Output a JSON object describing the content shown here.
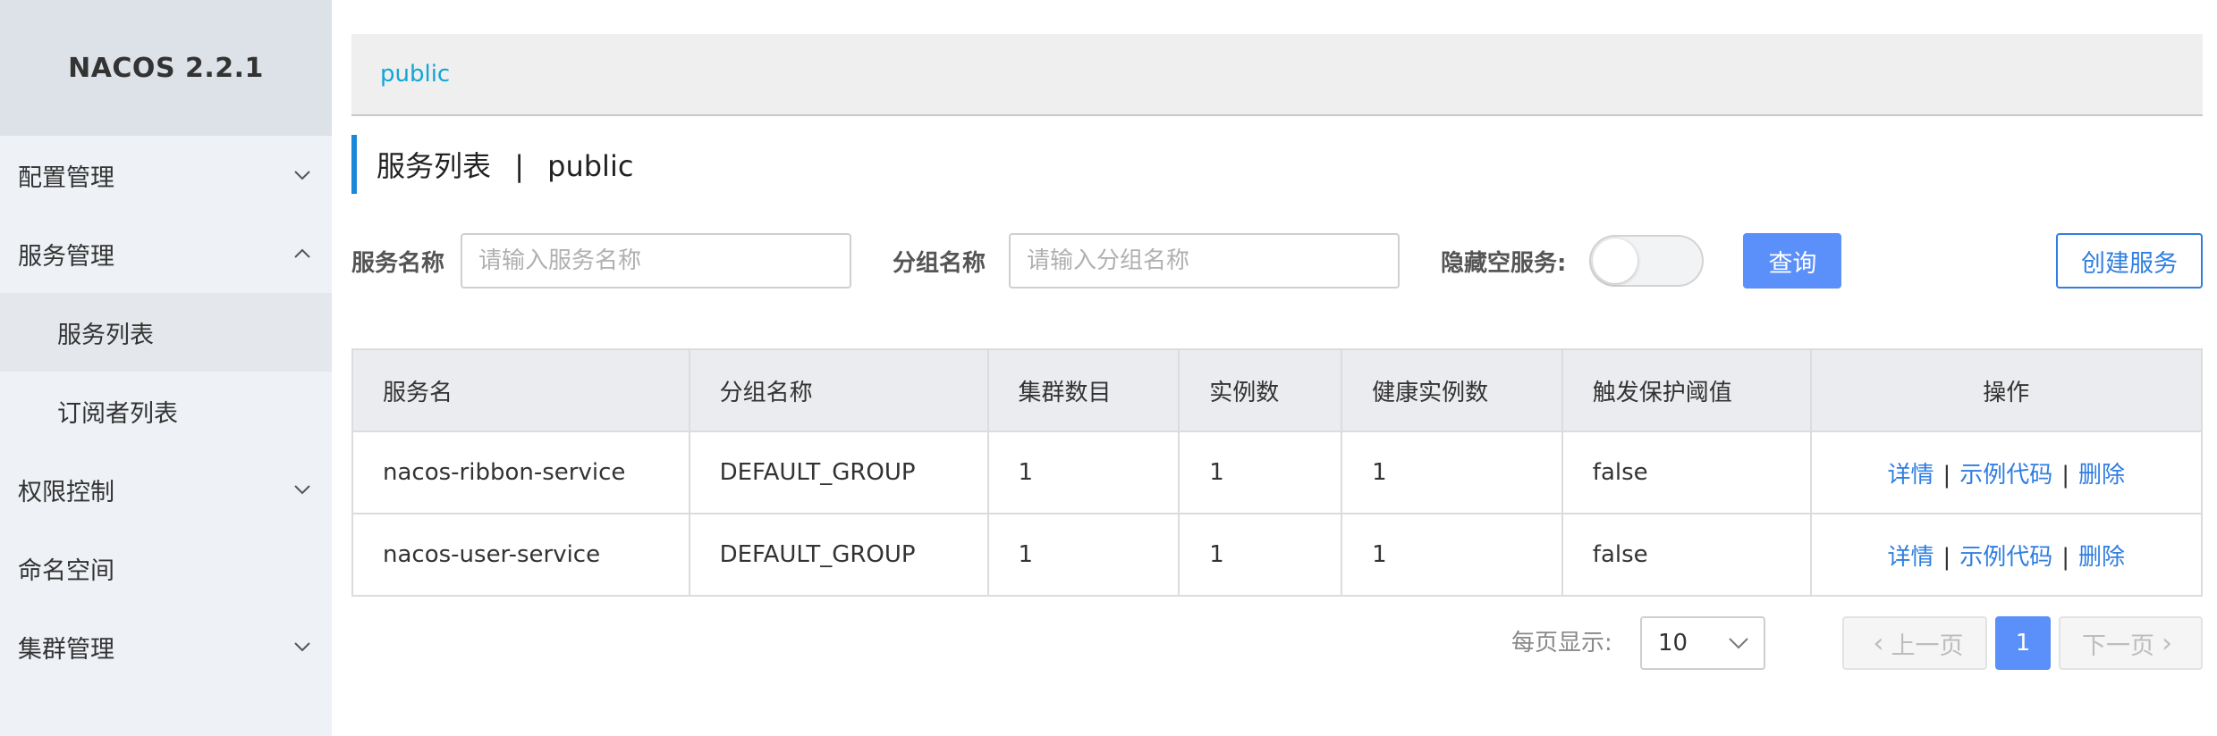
{
  "app": {
    "logo": "NACOS 2.2.1"
  },
  "sidebar": {
    "items": [
      {
        "label": "配置管理",
        "chevron": "down"
      },
      {
        "label": "服务管理",
        "chevron": "up"
      },
      {
        "label": "服务列表",
        "sub": true,
        "active": true
      },
      {
        "label": "订阅者列表",
        "sub": true
      },
      {
        "label": "权限控制",
        "chevron": "down"
      },
      {
        "label": "命名空间"
      },
      {
        "label": "集群管理",
        "chevron": "down"
      }
    ]
  },
  "namespace": {
    "current": "public"
  },
  "page": {
    "title": "服务列表",
    "separator": "|",
    "namespace": "public"
  },
  "filters": {
    "service_label": "服务名称",
    "service_placeholder": "请输入服务名称",
    "group_label": "分组名称",
    "group_placeholder": "请输入分组名称",
    "hide_empty_label": "隐藏空服务:",
    "hide_empty_on": false,
    "query_button": "查询",
    "create_button": "创建服务"
  },
  "table": {
    "headers": [
      "服务名",
      "分组名称",
      "集群数目",
      "实例数",
      "健康实例数",
      "触发保护阈值",
      "操作"
    ],
    "rows": [
      {
        "name": "nacos-ribbon-service",
        "group": "DEFAULT_GROUP",
        "clusters": "1",
        "instances": "1",
        "healthy": "1",
        "threshold": "false"
      },
      {
        "name": "nacos-user-service",
        "group": "DEFAULT_GROUP",
        "clusters": "1",
        "instances": "1",
        "healthy": "1",
        "threshold": "false"
      }
    ],
    "actions": {
      "detail": "详情",
      "sample": "示例代码",
      "delete": "删除",
      "sep": "|"
    }
  },
  "pagination": {
    "per_page_label": "每页显示:",
    "per_page_value": "10",
    "prev": "上一页",
    "next": "下一页",
    "current_page": "1"
  },
  "colors": {
    "primary": "#5b8ff9",
    "link": "#2f7ee0",
    "namespace_link": "#12a5d6",
    "title_accent": "#1a88d8"
  }
}
